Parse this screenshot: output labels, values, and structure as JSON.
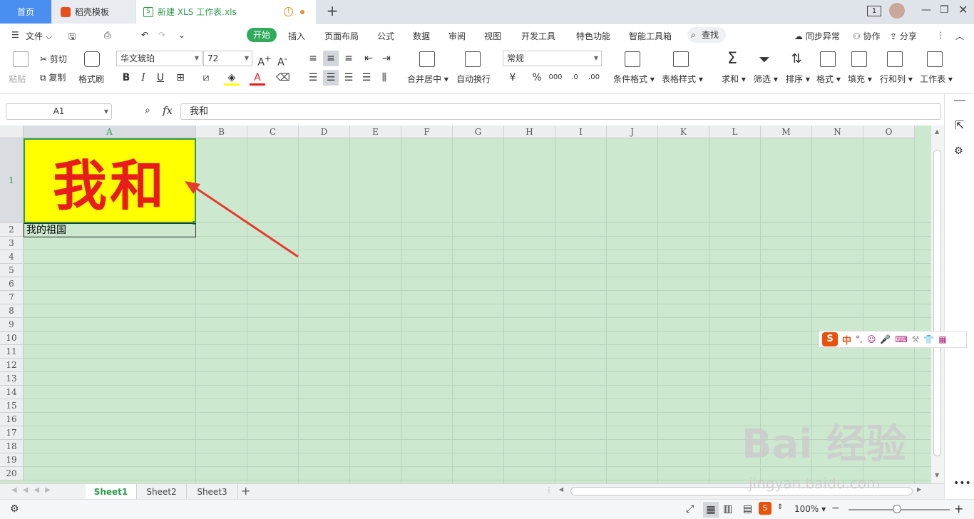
{
  "tabs": {
    "home": "首页",
    "docer": "稻壳模板",
    "file": "新建 XLS 工作表.xls"
  },
  "window": {
    "page_count": "1"
  },
  "menu": {
    "file": "文件",
    "items": [
      "开始",
      "插入",
      "页面布局",
      "公式",
      "数据",
      "审阅",
      "视图",
      "开发工具",
      "特色功能",
      "智能工具箱"
    ],
    "search": "查找",
    "sync": "同步异常",
    "collab": "协作",
    "share": "分享"
  },
  "ribbon": {
    "paste": "粘贴",
    "cut": "剪切",
    "copy": "复制",
    "format_painter": "格式刷",
    "font_name": "华文琥珀",
    "font_size": "72",
    "merge_center": "合并居中",
    "wrap": "自动换行",
    "number_format": "常规",
    "currency": "¥",
    "percent": "%",
    "cond_format": "条件格式",
    "table_style": "表格样式",
    "sum": "求和",
    "filter": "筛选",
    "sort": "排序",
    "format": "格式",
    "fill": "填充",
    "row_col": "行和列",
    "worksheet": "工作表"
  },
  "formula": {
    "cell_ref": "A1",
    "fx": "fx",
    "content": "我和"
  },
  "grid": {
    "columns": [
      "A",
      "B",
      "C",
      "D",
      "E",
      "F",
      "G",
      "H",
      "I",
      "J",
      "K",
      "L",
      "M",
      "N",
      "O"
    ],
    "rows": [
      "1",
      "2",
      "3",
      "4",
      "5",
      "6",
      "7",
      "8",
      "9",
      "10",
      "11",
      "12",
      "13",
      "14",
      "15",
      "16",
      "17",
      "18",
      "19",
      "20"
    ],
    "a1": "我和",
    "a2": "我的祖国"
  },
  "sheets": [
    "Sheet1",
    "Sheet2",
    "Sheet3"
  ],
  "status": {
    "zoom": "100%"
  },
  "ime": {
    "mode": "中"
  },
  "watermark": {
    "main": "Bai 经验",
    "sub": "jingyan.baidu.com"
  },
  "colors": {
    "accent": "#2fab5b",
    "cell_fill": "#ffff00",
    "cell_text": "#e81c1c",
    "eye_protect_bg": "#cce8cf"
  }
}
